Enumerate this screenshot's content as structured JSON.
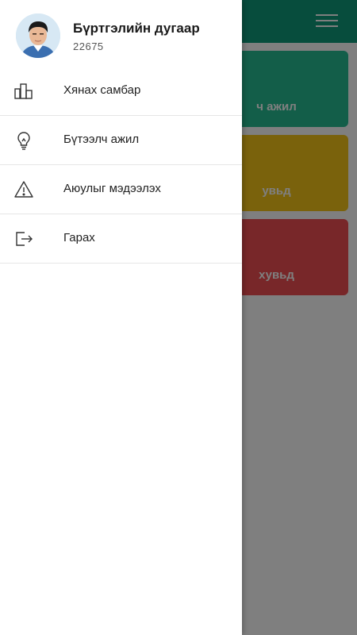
{
  "app_bar": {
    "color": "#0f9b7a",
    "menu_icon": "hamburger-icon"
  },
  "cards": [
    {
      "label": "ч ажил",
      "color": "#27bd93"
    },
    {
      "label": "увьд",
      "color": "#f5c518"
    },
    {
      "label": "хувьд",
      "color": "#f04e52"
    }
  ],
  "drawer": {
    "user": {
      "title": "Бүртгэлийн дугаар",
      "number": "22675",
      "avatar_icon": "user-avatar"
    },
    "items": [
      {
        "label": "Хянах самбар",
        "icon": "bar-chart-icon"
      },
      {
        "label": "Бүтээлч ажил",
        "icon": "lightbulb-icon"
      },
      {
        "label": "Аюулыг мэдээлэх",
        "icon": "warning-icon"
      },
      {
        "label": "Гарах",
        "icon": "logout-icon"
      }
    ]
  }
}
